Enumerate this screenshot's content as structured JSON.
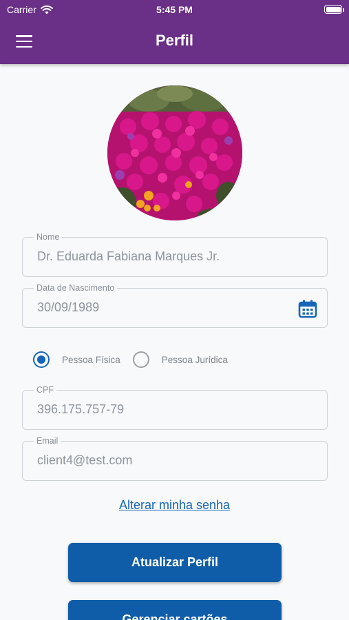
{
  "status_bar": {
    "carrier": "Carrier",
    "time": "5:45 PM"
  },
  "app_bar": {
    "title": "Perfil",
    "menu_icon": "hamburger-menu-icon",
    "background_color": "#6a2f86"
  },
  "profile": {
    "avatar_icon": "profile-photo-flowers"
  },
  "form": {
    "name": {
      "label": "Nome",
      "value": "Dr. Eduarda Fabiana Marques Jr."
    },
    "birthdate": {
      "label": "Data de Nascimento",
      "value": "30/09/1989",
      "icon": "calendar-icon"
    },
    "person_type": {
      "options": [
        {
          "label": "Pessoa Física",
          "selected": true
        },
        {
          "label": "Pessoa Jurídica",
          "selected": false
        }
      ]
    },
    "cpf": {
      "label": "CPF",
      "value": "396.175.757-79"
    },
    "email": {
      "label": "Email",
      "value": "client4@test.com"
    }
  },
  "change_password_link": "Alterar minha senha",
  "buttons": {
    "update_profile": "Atualizar Perfil",
    "manage_cards": "Gerenciar cartões"
  },
  "colors": {
    "accent": "#1565b8",
    "button": "#0f5ca8"
  }
}
